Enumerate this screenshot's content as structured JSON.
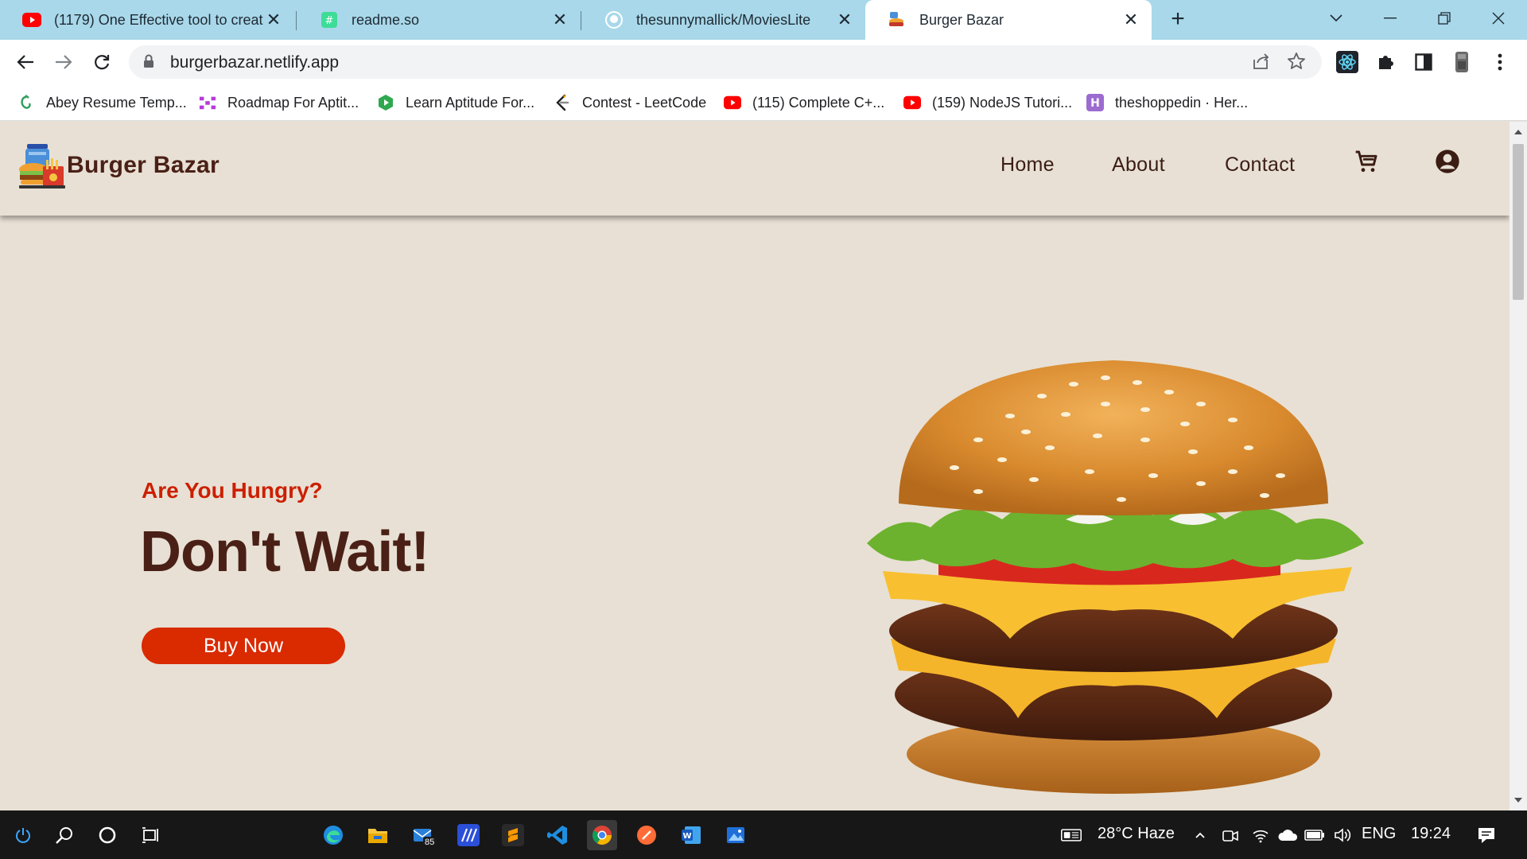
{
  "browser": {
    "tabs": [
      {
        "label": "(1179) One Effective tool to creat",
        "icon": "youtube-icon",
        "active": false
      },
      {
        "label": "readme.so",
        "icon": "readme-icon",
        "active": false
      },
      {
        "label": "thesunnymallick/MoviesLite",
        "icon": "github-icon",
        "active": false
      },
      {
        "label": "Burger Bazar",
        "icon": "burger-favicon-icon",
        "active": true
      }
    ],
    "new_tab_label": "+",
    "address": "burgerbazar.netlify.app",
    "bookmarks": [
      {
        "label": "Abey Resume Temp...",
        "icon": "resume-icon"
      },
      {
        "label": "Roadmap For Aptit...",
        "icon": "roadmap-icon"
      },
      {
        "label": "Learn Aptitude For...",
        "icon": "aptitude-icon"
      },
      {
        "label": "Contest - LeetCode",
        "icon": "leetcode-icon"
      },
      {
        "label": "(115) Complete C+...",
        "icon": "youtube-icon"
      },
      {
        "label": "(159) NodeJS Tutori...",
        "icon": "youtube-icon"
      },
      {
        "label": "theshoppedin · Her...",
        "icon": "heroku-icon"
      }
    ]
  },
  "site": {
    "brand": "Burger Bazar",
    "nav": {
      "home": "Home",
      "about": "About",
      "contact": "Contact"
    },
    "hero": {
      "kicker": "Are You Hungry?",
      "headline": "Don't Wait!",
      "cta": "Buy Now"
    }
  },
  "taskbar": {
    "mail_badge": "85",
    "weather": "28°C  Haze",
    "language": "ENG",
    "time": "19:24"
  },
  "colors": {
    "page_bg": "#e8e0d4",
    "brand_brown": "#4a2016",
    "accent_red": "#d92a00",
    "tab_strip": "#a8d8ea"
  }
}
